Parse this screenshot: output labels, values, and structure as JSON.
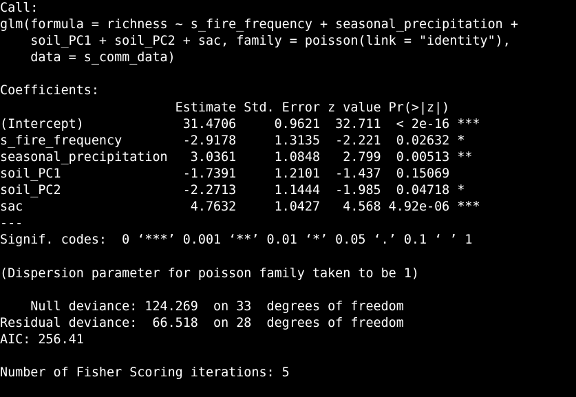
{
  "console": {
    "call_header": "Call:",
    "call_lines": [
      "glm(formula = richness ~ s_fire_frequency + seasonal_precipitation +",
      "    soil_PC1 + soil_PC2 + sac, family = poisson(link = \"identity\"),",
      "    data = s_comm_data)"
    ],
    "coefficients_header": "Coefficients:",
    "table_header": "                       Estimate Std. Error z value Pr(>|z|)    ",
    "rows": [
      "(Intercept)             31.4706     0.9621  32.711  < 2e-16 ***",
      "s_fire_frequency        -2.9178     1.3135  -2.221  0.02632 *  ",
      "seasonal_precipitation   3.0361     1.0848   2.799  0.00513 ** ",
      "soil_PC1                -1.7391     1.2101  -1.437  0.15069    ",
      "soil_PC2                -2.2713     1.1444  -1.985  0.04718 *  ",
      "sac                      4.7632     1.0427   4.568 4.92e-06 ***"
    ],
    "separator": "---",
    "signif_codes": "Signif. codes:  0 ‘***’ 0.001 ‘**’ 0.01 ‘*’ 0.05 ‘.’ 0.1 ‘ ’ 1",
    "dispersion": "(Dispersion parameter for poisson family taken to be 1)",
    "null_deviance": "    Null deviance: 124.269  on 33  degrees of freedom",
    "residual_deviance": "Residual deviance:  66.518  on 28  degrees of freedom",
    "aic": "AIC: 256.41",
    "fisher": "Number of Fisher Scoring iterations: 5"
  }
}
